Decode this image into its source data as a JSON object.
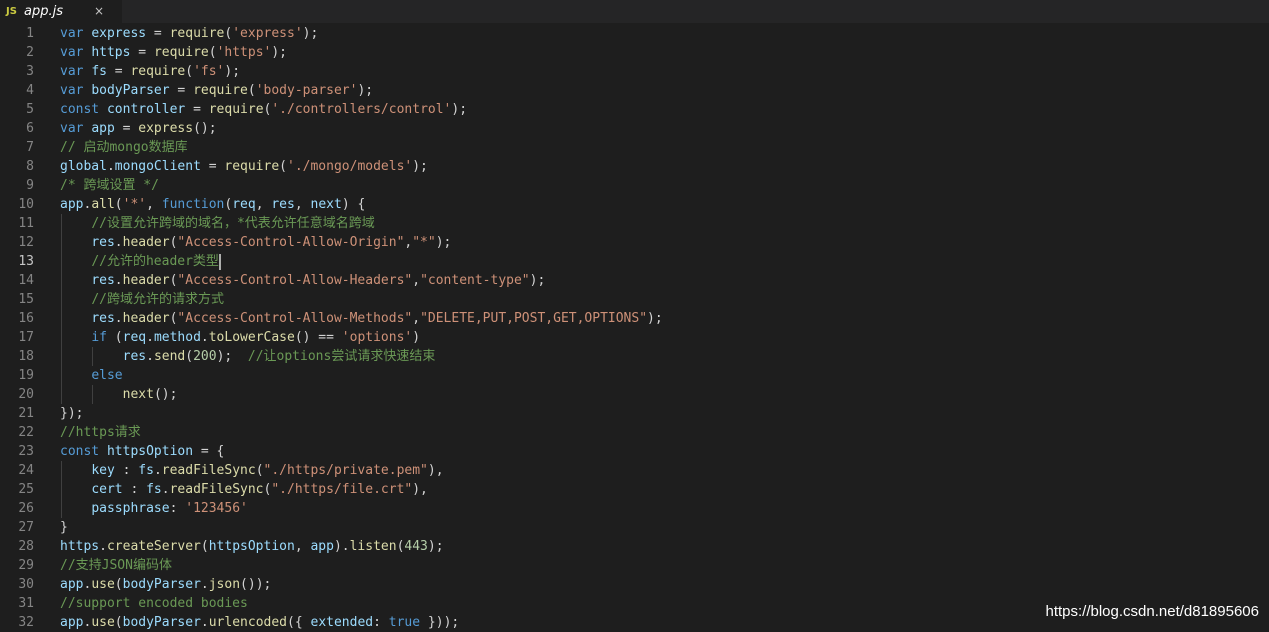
{
  "tab": {
    "icon_text": "JS",
    "filename": "app.js",
    "close_glyph": "×"
  },
  "code_lines": [
    {
      "n": "1",
      "tokens": [
        [
          "kw",
          "var "
        ],
        [
          "id",
          "express"
        ],
        [
          "pl",
          " = "
        ],
        [
          "fn",
          "require"
        ],
        [
          "pl",
          "("
        ],
        [
          "str",
          "'express'"
        ],
        [
          "pl",
          ");"
        ]
      ]
    },
    {
      "n": "2",
      "tokens": [
        [
          "kw",
          "var "
        ],
        [
          "id",
          "https"
        ],
        [
          "pl",
          " = "
        ],
        [
          "fn",
          "require"
        ],
        [
          "pl",
          "("
        ],
        [
          "str",
          "'https'"
        ],
        [
          "pl",
          ");"
        ]
      ]
    },
    {
      "n": "3",
      "tokens": [
        [
          "kw",
          "var "
        ],
        [
          "id",
          "fs"
        ],
        [
          "pl",
          " = "
        ],
        [
          "fn",
          "require"
        ],
        [
          "pl",
          "("
        ],
        [
          "str",
          "'fs'"
        ],
        [
          "pl",
          ");"
        ]
      ]
    },
    {
      "n": "4",
      "tokens": [
        [
          "kw",
          "var "
        ],
        [
          "id",
          "bodyParser"
        ],
        [
          "pl",
          " = "
        ],
        [
          "fn",
          "require"
        ],
        [
          "pl",
          "("
        ],
        [
          "str",
          "'body-parser'"
        ],
        [
          "pl",
          ");"
        ]
      ]
    },
    {
      "n": "5",
      "tokens": [
        [
          "kw",
          "const "
        ],
        [
          "id",
          "controller"
        ],
        [
          "pl",
          " = "
        ],
        [
          "fn",
          "require"
        ],
        [
          "pl",
          "("
        ],
        [
          "str",
          "'./controllers/control'"
        ],
        [
          "pl",
          ");"
        ]
      ]
    },
    {
      "n": "6",
      "tokens": [
        [
          "kw",
          "var "
        ],
        [
          "id",
          "app"
        ],
        [
          "pl",
          " = "
        ],
        [
          "fn",
          "express"
        ],
        [
          "pl",
          "();"
        ]
      ]
    },
    {
      "n": "7",
      "tokens": [
        [
          "cm",
          "// 启动mongo数据库"
        ]
      ]
    },
    {
      "n": "8",
      "tokens": [
        [
          "id",
          "global"
        ],
        [
          "pl",
          "."
        ],
        [
          "id",
          "mongoClient"
        ],
        [
          "pl",
          " = "
        ],
        [
          "fn",
          "require"
        ],
        [
          "pl",
          "("
        ],
        [
          "str",
          "'./mongo/models'"
        ],
        [
          "pl",
          ");"
        ]
      ]
    },
    {
      "n": "9",
      "tokens": [
        [
          "cm",
          "/* 跨域设置 */"
        ]
      ]
    },
    {
      "n": "10",
      "tokens": [
        [
          "id",
          "app"
        ],
        [
          "pl",
          "."
        ],
        [
          "fn",
          "all"
        ],
        [
          "pl",
          "("
        ],
        [
          "str",
          "'*'"
        ],
        [
          "pl",
          ", "
        ],
        [
          "kw",
          "function"
        ],
        [
          "pl",
          "("
        ],
        [
          "id",
          "req"
        ],
        [
          "pl",
          ", "
        ],
        [
          "id",
          "res"
        ],
        [
          "pl",
          ", "
        ],
        [
          "id",
          "next"
        ],
        [
          "pl",
          ") {"
        ]
      ]
    },
    {
      "n": "11",
      "tokens": [
        [
          "pl",
          "    "
        ],
        [
          "cm",
          "//设置允许跨域的域名，*代表允许任意域名跨域"
        ]
      ]
    },
    {
      "n": "12",
      "tokens": [
        [
          "pl",
          "    "
        ],
        [
          "id",
          "res"
        ],
        [
          "pl",
          "."
        ],
        [
          "fn",
          "header"
        ],
        [
          "pl",
          "("
        ],
        [
          "str",
          "\"Access-Control-Allow-Origin\""
        ],
        [
          "pl",
          ","
        ],
        [
          "str",
          "\"*\""
        ],
        [
          "pl",
          ");"
        ]
      ]
    },
    {
      "n": "13",
      "current": true,
      "tokens": [
        [
          "pl",
          "    "
        ],
        [
          "cm",
          "//允许的header类型"
        ]
      ]
    },
    {
      "n": "14",
      "tokens": [
        [
          "pl",
          "    "
        ],
        [
          "id",
          "res"
        ],
        [
          "pl",
          "."
        ],
        [
          "fn",
          "header"
        ],
        [
          "pl",
          "("
        ],
        [
          "str",
          "\"Access-Control-Allow-Headers\""
        ],
        [
          "pl",
          ","
        ],
        [
          "str",
          "\"content-type\""
        ],
        [
          "pl",
          ");"
        ]
      ]
    },
    {
      "n": "15",
      "tokens": [
        [
          "pl",
          "    "
        ],
        [
          "cm",
          "//跨域允许的请求方式"
        ]
      ]
    },
    {
      "n": "16",
      "tokens": [
        [
          "pl",
          "    "
        ],
        [
          "id",
          "res"
        ],
        [
          "pl",
          "."
        ],
        [
          "fn",
          "header"
        ],
        [
          "pl",
          "("
        ],
        [
          "str",
          "\"Access-Control-Allow-Methods\""
        ],
        [
          "pl",
          ","
        ],
        [
          "str",
          "\"DELETE,PUT,POST,GET,OPTIONS\""
        ],
        [
          "pl",
          ");"
        ]
      ]
    },
    {
      "n": "17",
      "tokens": [
        [
          "pl",
          "    "
        ],
        [
          "kw",
          "if"
        ],
        [
          "pl",
          " ("
        ],
        [
          "id",
          "req"
        ],
        [
          "pl",
          "."
        ],
        [
          "id",
          "method"
        ],
        [
          "pl",
          "."
        ],
        [
          "fn",
          "toLowerCase"
        ],
        [
          "pl",
          "() == "
        ],
        [
          "str",
          "'options'"
        ],
        [
          "pl",
          ")"
        ]
      ]
    },
    {
      "n": "18",
      "tokens": [
        [
          "pl",
          "        "
        ],
        [
          "id",
          "res"
        ],
        [
          "pl",
          "."
        ],
        [
          "fn",
          "send"
        ],
        [
          "pl",
          "("
        ],
        [
          "num",
          "200"
        ],
        [
          "pl",
          ");  "
        ],
        [
          "cm",
          "//让options尝试请求快速结束"
        ]
      ]
    },
    {
      "n": "19",
      "tokens": [
        [
          "pl",
          "    "
        ],
        [
          "kw",
          "else"
        ]
      ]
    },
    {
      "n": "20",
      "tokens": [
        [
          "pl",
          "        "
        ],
        [
          "fn",
          "next"
        ],
        [
          "pl",
          "();"
        ]
      ]
    },
    {
      "n": "21",
      "tokens": [
        [
          "pl",
          "});"
        ]
      ]
    },
    {
      "n": "22",
      "tokens": [
        [
          "cm",
          "//https请求"
        ]
      ]
    },
    {
      "n": "23",
      "tokens": [
        [
          "kw",
          "const "
        ],
        [
          "id",
          "httpsOption"
        ],
        [
          "pl",
          " = {"
        ]
      ]
    },
    {
      "n": "24",
      "tokens": [
        [
          "pl",
          "    "
        ],
        [
          "id",
          "key"
        ],
        [
          "pl",
          " : "
        ],
        [
          "id",
          "fs"
        ],
        [
          "pl",
          "."
        ],
        [
          "fn",
          "readFileSync"
        ],
        [
          "pl",
          "("
        ],
        [
          "str",
          "\"./https/private.pem\""
        ],
        [
          "pl",
          "),"
        ]
      ]
    },
    {
      "n": "25",
      "tokens": [
        [
          "pl",
          "    "
        ],
        [
          "id",
          "cert"
        ],
        [
          "pl",
          " : "
        ],
        [
          "id",
          "fs"
        ],
        [
          "pl",
          "."
        ],
        [
          "fn",
          "readFileSync"
        ],
        [
          "pl",
          "("
        ],
        [
          "str",
          "\"./https/file.crt\""
        ],
        [
          "pl",
          "),"
        ]
      ]
    },
    {
      "n": "26",
      "tokens": [
        [
          "pl",
          "    "
        ],
        [
          "id",
          "passphrase"
        ],
        [
          "pl",
          ": "
        ],
        [
          "str",
          "'123456'"
        ]
      ]
    },
    {
      "n": "27",
      "tokens": [
        [
          "pl",
          "}"
        ]
      ]
    },
    {
      "n": "28",
      "tokens": [
        [
          "id",
          "https"
        ],
        [
          "pl",
          "."
        ],
        [
          "fn",
          "createServer"
        ],
        [
          "pl",
          "("
        ],
        [
          "id",
          "httpsOption"
        ],
        [
          "pl",
          ", "
        ],
        [
          "id",
          "app"
        ],
        [
          "pl",
          ")."
        ],
        [
          "fn",
          "listen"
        ],
        [
          "pl",
          "("
        ],
        [
          "num",
          "443"
        ],
        [
          "pl",
          ");"
        ]
      ]
    },
    {
      "n": "29",
      "tokens": [
        [
          "cm",
          "//支持JSON编码体"
        ]
      ]
    },
    {
      "n": "30",
      "tokens": [
        [
          "id",
          "app"
        ],
        [
          "pl",
          "."
        ],
        [
          "fn",
          "use"
        ],
        [
          "pl",
          "("
        ],
        [
          "id",
          "bodyParser"
        ],
        [
          "pl",
          "."
        ],
        [
          "fn",
          "json"
        ],
        [
          "pl",
          "());"
        ]
      ]
    },
    {
      "n": "31",
      "tokens": [
        [
          "cm",
          "//support encoded bodies"
        ]
      ]
    },
    {
      "n": "32",
      "tokens": [
        [
          "id",
          "app"
        ],
        [
          "pl",
          "."
        ],
        [
          "fn",
          "use"
        ],
        [
          "pl",
          "("
        ],
        [
          "id",
          "bodyParser"
        ],
        [
          "pl",
          "."
        ],
        [
          "fn",
          "urlencoded"
        ],
        [
          "pl",
          "({ "
        ],
        [
          "id",
          "extended"
        ],
        [
          "pl",
          ": "
        ],
        [
          "kw",
          "true"
        ],
        [
          "pl",
          " }));"
        ]
      ]
    }
  ],
  "watermark": "https://blog.csdn.net/d81895606",
  "colors": {
    "background": "#1e1e1e",
    "keyword": "#569cd6",
    "identifier": "#9cdcfe",
    "function": "#dcdcaa",
    "string": "#ce9178",
    "number": "#b5cea8",
    "comment": "#6a9955"
  }
}
